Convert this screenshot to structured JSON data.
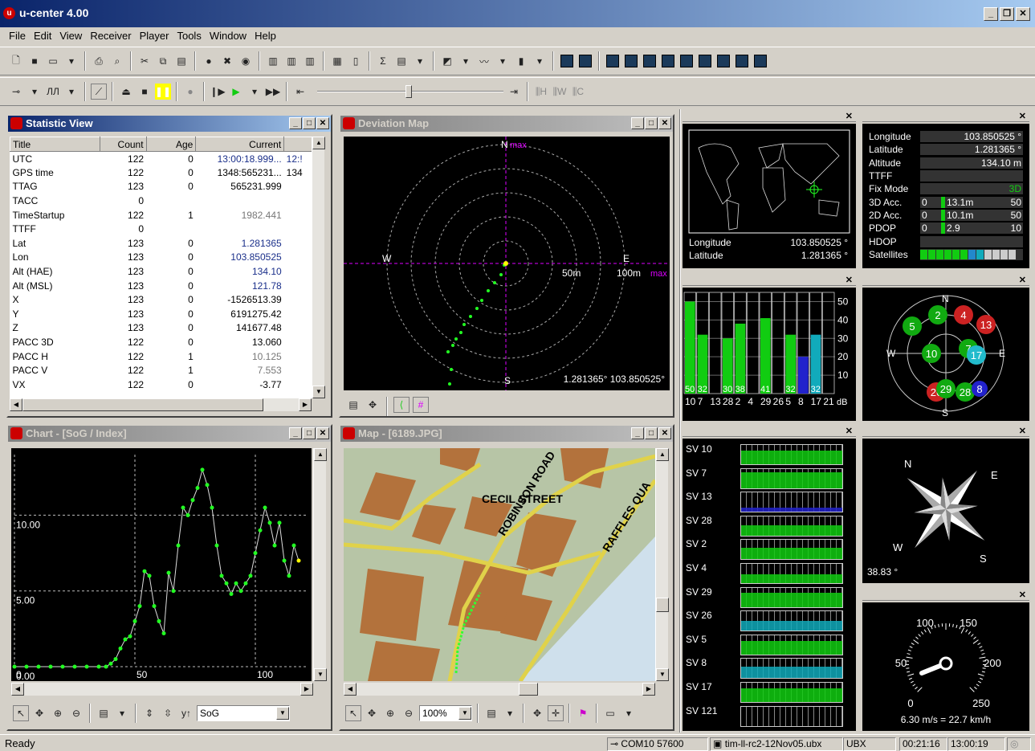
{
  "app": {
    "title": "u-center 4.00",
    "logo": "u"
  },
  "menu": [
    "File",
    "Edit",
    "View",
    "Receiver",
    "Player",
    "Tools",
    "Window",
    "Help"
  ],
  "statistic_view": {
    "title": "Statistic View",
    "columns": [
      "Title",
      "Count",
      "Age",
      "Current"
    ],
    "col5_partial": [
      "12:!",
      "134"
    ],
    "rows": [
      [
        "UTC",
        "122",
        "0",
        "13:00:18.999..."
      ],
      [
        "GPS time",
        "122",
        "0",
        "1348:565231..."
      ],
      [
        "TTAG",
        "123",
        "0",
        "565231.999"
      ],
      [
        "TACC",
        "0",
        "",
        ""
      ],
      [
        "TimeStartup",
        "122",
        "1",
        "1982.441"
      ],
      [
        "TTFF",
        "0",
        "",
        ""
      ],
      [
        "Lat",
        "123",
        "0",
        "1.281365"
      ],
      [
        "Lon",
        "123",
        "0",
        "103.850525"
      ],
      [
        "Alt (HAE)",
        "123",
        "0",
        "134.10"
      ],
      [
        "Alt (MSL)",
        "123",
        "0",
        "121.78"
      ],
      [
        "X",
        "123",
        "0",
        "-1526513.39"
      ],
      [
        "Y",
        "123",
        "0",
        "6191275.42"
      ],
      [
        "Z",
        "123",
        "0",
        "141677.48"
      ],
      [
        "PACC 3D",
        "122",
        "0",
        "13.060"
      ],
      [
        "PACC H",
        "122",
        "1",
        "10.125"
      ],
      [
        "PACC V",
        "122",
        "1",
        "7.553"
      ],
      [
        "VX",
        "122",
        "0",
        "-3.77"
      ]
    ]
  },
  "deviation_map": {
    "title": "Deviation Map",
    "N": "N",
    "S": "S",
    "E": "E",
    "W": "W",
    "max": "max",
    "max_right": "max",
    "ring1": "50m",
    "ring2": "100m",
    "coords": "1.281365° 103.850525°"
  },
  "chart": {
    "title": "Chart - [SoG / Index]",
    "channel": "SoG"
  },
  "map": {
    "title": "Map - [6189.JPG]",
    "zoom": "100%",
    "streets": [
      "CECIL STREET",
      "ROBINSON ROAD",
      "RAFFLES QUA"
    ]
  },
  "world_map": {
    "lon_label": "Longitude",
    "lon_val": "103.850525 °",
    "lat_label": "Latitude",
    "lat_val": "1.281365 °"
  },
  "data_panel": {
    "rows": [
      [
        "Longitude",
        "",
        "103.850525 °"
      ],
      [
        "Latitude",
        "",
        "1.281365 °"
      ],
      [
        "Altitude",
        "",
        "134.10 m"
      ],
      [
        "TTFF",
        "",
        ""
      ],
      [
        "Fix Mode",
        "",
        "3D"
      ],
      [
        "3D Acc.",
        "0",
        "13.1m",
        "50"
      ],
      [
        "2D Acc.",
        "0",
        "10.1m",
        "50"
      ],
      [
        "PDOP",
        "0",
        "2.9",
        "10"
      ],
      [
        "HDOP",
        "",
        ""
      ],
      [
        "Satellites",
        "",
        ""
      ]
    ]
  },
  "sky_view": {
    "N": "N",
    "S": "S",
    "E": "E",
    "W": "W"
  },
  "compass": {
    "N": "N",
    "E": "E",
    "S": "S",
    "W": "W",
    "heading": "38.83 °"
  },
  "speedo": {
    "ticks": [
      "100",
      "150",
      "50",
      "200",
      "0",
      "250"
    ],
    "reading": "6.30 m/s = 22.7 km/h"
  },
  "sv_list": [
    "SV 10",
    "SV 7",
    "SV 13",
    "SV 28",
    "SV 2",
    "SV 4",
    "SV 29",
    "SV 26",
    "SV 5",
    "SV 8",
    "SV 17",
    "SV 121"
  ],
  "signal_chart": {
    "top_labels": [
      "50",
      "32",
      "",
      "30",
      "38",
      "",
      "41",
      "",
      "32",
      "",
      "32",
      ""
    ],
    "bottom_labels": [
      "10",
      "7",
      "13",
      "28",
      "2",
      "4",
      "29",
      "26",
      "5",
      "8",
      "17",
      "21"
    ],
    "unit": "dB",
    "y_ticks": [
      "50",
      "40",
      "30",
      "20",
      "10"
    ]
  },
  "status": {
    "ready": "Ready",
    "port": "COM10",
    "baud": "57600",
    "file": "tim-ll-rc2-12Nov05.ubx",
    "proto": "UBX",
    "time1": "00:21:16",
    "time2": "13:00:19"
  },
  "chart_data": {
    "type": "line",
    "x_ticks": [
      "0",
      "50",
      "100"
    ],
    "y_ticks": [
      "0.00",
      "5.00",
      "10.00"
    ],
    "ylim": [
      0,
      14
    ],
    "xlim": [
      0,
      122
    ],
    "x": [
      0,
      5,
      10,
      15,
      20,
      25,
      30,
      35,
      38,
      40,
      42,
      44,
      46,
      48,
      50,
      52,
      54,
      56,
      58,
      60,
      62,
      64,
      66,
      68,
      70,
      72,
      74,
      76,
      78,
      80,
      82,
      84,
      86,
      88,
      90,
      92,
      94,
      96,
      98,
      100,
      102,
      104,
      106,
      108,
      110,
      112,
      114,
      116,
      118
    ],
    "values": [
      0,
      0,
      0,
      0,
      0,
      0,
      0,
      0,
      0,
      0.2,
      0.5,
      1.2,
      1.8,
      2.0,
      3.0,
      4.0,
      6.3,
      6.0,
      4.0,
      3.0,
      2.2,
      6.2,
      5.0,
      8.0,
      10.5,
      10.0,
      11.0,
      11.8,
      13.0,
      12.0,
      10.5,
      8.0,
      6.0,
      5.5,
      4.8,
      5.5,
      5.0,
      5.5,
      6.0,
      7.5,
      9.0,
      10.5,
      9.5,
      8.0,
      9.5,
      7.0,
      6.0,
      8.0,
      7.0
    ]
  }
}
